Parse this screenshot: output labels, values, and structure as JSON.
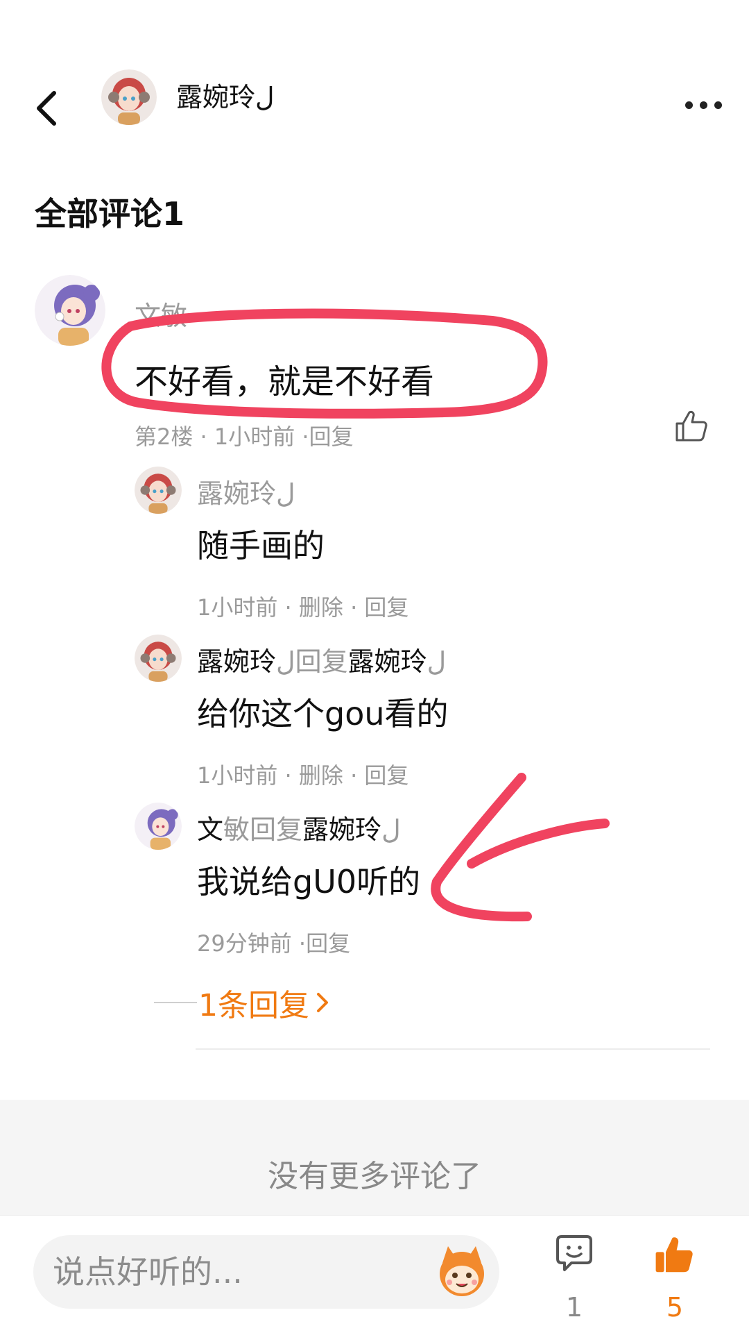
{
  "header": {
    "username": "露婉玲",
    "username_suffix": "ل"
  },
  "section": {
    "title": "全部评论1"
  },
  "main_comment": {
    "author": "文敏",
    "text": "不好看，就是不好看",
    "meta": "第2楼 · 1小时前 ·",
    "reply_label": "回复"
  },
  "replies": [
    {
      "author": "露婉玲",
      "author_suffix": "ل",
      "text": "随手画的",
      "time": "1小时前 ·",
      "delete_label": " 删除 ·",
      "reply_label": " 回复"
    },
    {
      "author": "露婉玲",
      "author_suffix": "ل",
      "reply_word": "回复",
      "target": "露婉玲",
      "target_suffix": "ل",
      "text": "给你这个gou看的",
      "time": "1小时前 ·",
      "delete_label": " 删除 ·",
      "reply_label": " 回复"
    },
    {
      "author": "文",
      "author_rest": "敏",
      "reply_word": "回复",
      "target": "露婉玲",
      "target_suffix": "ل",
      "text": "我说给gU0听的",
      "time": "29分钟前 ·",
      "reply_label": "回复"
    }
  ],
  "more_replies": {
    "label": "1条回复"
  },
  "footer": {
    "no_more": "没有更多评论了"
  },
  "bottom_bar": {
    "input_placeholder": "说点好听的...",
    "comment_count": "1",
    "like_count": "5"
  },
  "colors": {
    "accent": "#f07a12",
    "annotation": "#f0435f",
    "muted": "#9a9a9a"
  },
  "icons": [
    "back-arrow-icon",
    "more-dots-icon",
    "thumbs-up-icon",
    "chevron-right-icon",
    "emoji-mascot-icon",
    "comment-bubble-icon",
    "thumbs-up-filled-icon"
  ]
}
